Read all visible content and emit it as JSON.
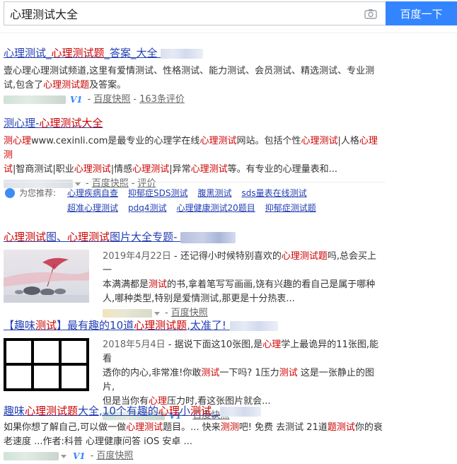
{
  "search": {
    "query": "心理测试大全",
    "button": "百度一下"
  },
  "results": [
    {
      "title_a": "心理测试_",
      "title_b": "心理测试题",
      "title_c": "_答案_大全",
      "abstract_1": "壹心理心理测试频道,这里有爱情测试、性格测试、能力测试、会员测试、精选测试、专业测",
      "abstract_2a": "试,包含了",
      "abstract_2b": "心理测试题",
      "abstract_2c": "及答案。",
      "snapshot": "百度快照",
      "reviews": "163条评价"
    },
    {
      "title_a": "测心理-",
      "title_b": "心理测试大全",
      "abstract_1a": "测心理",
      "abstract_1b": "www.cexinli.com是最专业的心理学在线",
      "abstract_1c": "心理测试",
      "abstract_1d": "网站。包括个性",
      "abstract_1e": "心理测试",
      "abstract_1f": "|人格",
      "abstract_1g": "心理测",
      "abstract_2a": "试",
      "abstract_2b": "|智商测试|职业",
      "abstract_2c": "心理测试",
      "abstract_2d": "|情感",
      "abstract_2e": "心理测试",
      "abstract_2f": "|异常",
      "abstract_2g": "心理测试",
      "abstract_2h": "等。有专业的心理量表和...",
      "snapshot": "百度快照",
      "reviews": "评价"
    },
    {
      "title_a": "心理测试",
      "title_b": "图、",
      "title_c": "心理测试",
      "title_d": "图片大全",
      "title_e": "专题-",
      "date": "2019年4月22日",
      "abstract_1a": " - 还记得小时候特别喜欢的",
      "abstract_1b": "心理测试题",
      "abstract_1c": "吗,总会买上一",
      "abstract_2a": "本满满都是",
      "abstract_2b": "测试",
      "abstract_2c": "的书,拿着笔写写画画,饶有兴趣的看自己是属于哪种",
      "abstract_3": "人,哪种类型,特别是爱情测试,那更是十分热衷...",
      "snapshot": "百度快照"
    },
    {
      "title_a": "【趣味",
      "title_b": "测试",
      "title_c": "】最有趣的10道",
      "title_d": "心理测试题",
      "title_e": ",太准了!",
      "date": "2018年5月4日",
      "abstract_1a": " - 据说下面这10张图,是",
      "abstract_1b": "心理",
      "abstract_1c": "学上最诡异的11张图,能看",
      "abstract_2a": "透你的内心,非常准!你敢",
      "abstract_2b": "测试",
      "abstract_2c": "一下吗? 1压力",
      "abstract_2d": "测试",
      "abstract_2e": " 这是一张静止的图片,",
      "abstract_3a": "但是当你有",
      "abstract_3b": "心理",
      "abstract_3c": "压力时,看这张图片就会...",
      "snapshot": "百度快照"
    },
    {
      "title_a": "趣味",
      "title_b": "心理测试题",
      "title_c": "大全",
      "title_d": ",10个有趣的",
      "title_e": "心理",
      "title_f": "小",
      "title_g": "测试",
      "title_h": "_",
      "abstract_1a": "如果你想了解自己,可以做一做",
      "abstract_1b": "心理测试",
      "abstract_1c": "题目。... 快来",
      "abstract_1d": "测测",
      "abstract_1e": "吧! 免费 去测试 21道",
      "abstract_1f": "题测试",
      "abstract_1g": "你的衰",
      "abstract_2": "老速度 ...作者:科普 心理健康问答 iOS 安卓 ...",
      "snapshot": "百度快照"
    }
  ],
  "recommend": {
    "label": "为您推荐:",
    "row1": [
      "心理疾病自查",
      "抑郁症SDS测试",
      "腹黑测试",
      "sds量表在线测试"
    ],
    "row2": [
      "超准心理测试",
      "pdq4测试",
      "心理健康测试20题目",
      "抑郁症测试题"
    ]
  },
  "colors": {
    "link": "#2440b3",
    "highlight": "#cc0000",
    "button": "#3385ff",
    "v_badge": "#3385ff"
  }
}
